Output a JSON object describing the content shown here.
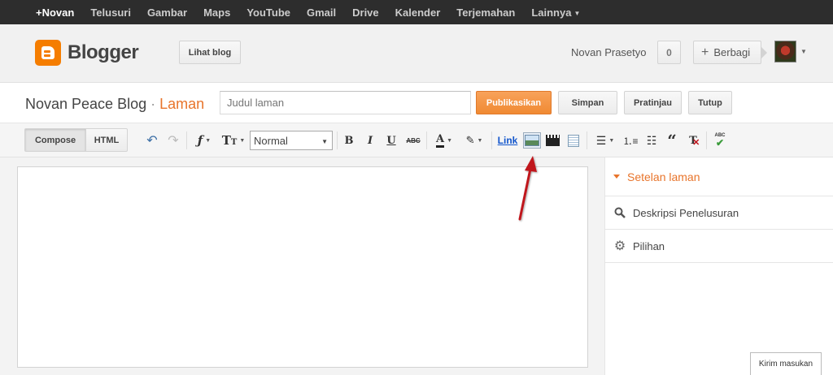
{
  "gbar": {
    "items": [
      "+Novan",
      "Telusuri",
      "Gambar",
      "Maps",
      "YouTube",
      "Gmail",
      "Drive",
      "Kalender",
      "Terjemahan",
      "Lainnya"
    ]
  },
  "header": {
    "logo_text": "Blogger",
    "view_blog": "Lihat blog",
    "user_name": "Novan Prasetyo",
    "notification_count": "0",
    "share_label": "Berbagi"
  },
  "post": {
    "blog_name": "Novan Peace Blog",
    "separator": "·",
    "page_type": "Laman",
    "title_placeholder": "Judul laman",
    "publish": "Publikasikan",
    "save": "Simpan",
    "preview": "Pratinjau",
    "close": "Tutup"
  },
  "toolbar": {
    "compose": "Compose",
    "html": "HTML",
    "font_size": "Normal",
    "bold": "B",
    "italic": "I",
    "underline": "U",
    "strike": "ABC",
    "link": "Link",
    "spellcheck": "ABC"
  },
  "sidebar": {
    "header": "Setelan laman",
    "items": [
      {
        "label": "Deskripsi Penelusuran",
        "icon": "search-icon"
      },
      {
        "label": "Pilihan",
        "icon": "gear-icon"
      }
    ]
  },
  "feedback": "Kirim masukan",
  "colors": {
    "accent": "#e8742b",
    "publish": "#f08a33",
    "gbar": "#2d2d2d",
    "link": "#1155cc",
    "annotation_arrow": "#c0141b"
  }
}
